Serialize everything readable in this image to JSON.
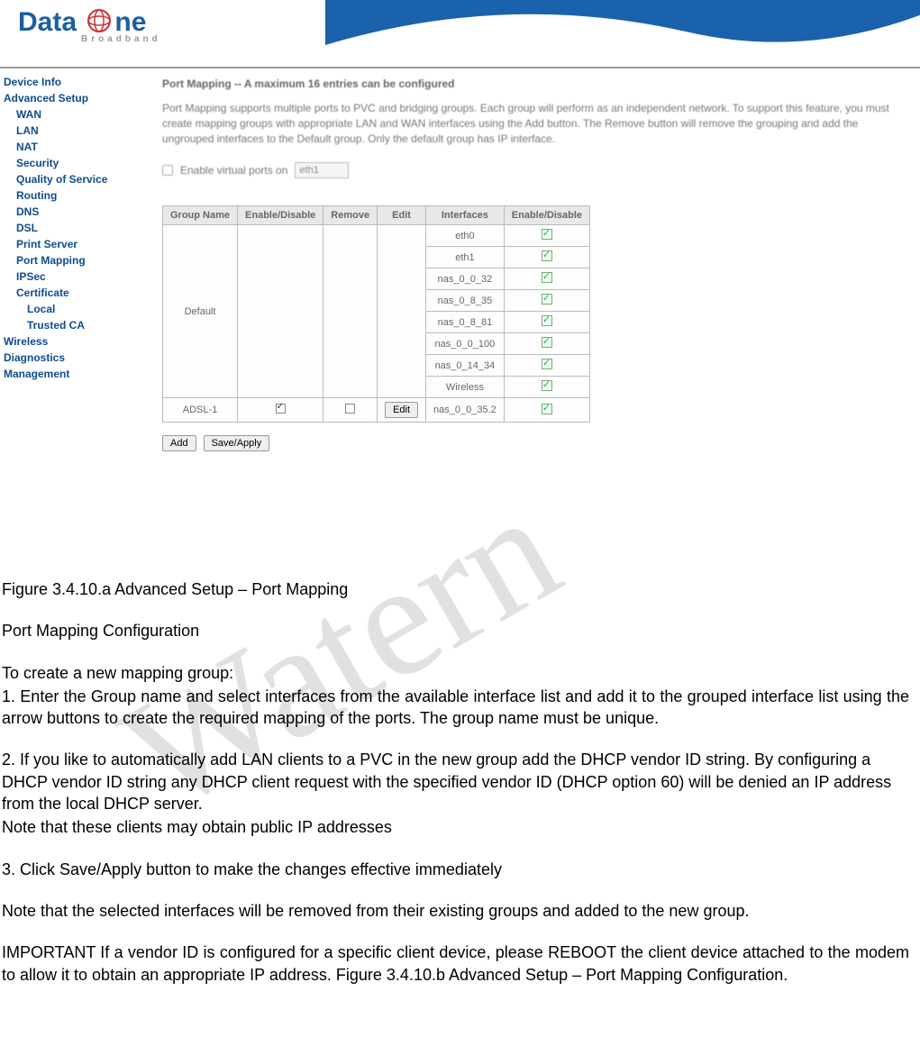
{
  "watermark": "Watern",
  "header": {
    "brand_a": "Data",
    "brand_b": "ne",
    "sub": "Broadband"
  },
  "sidebar": {
    "items": [
      {
        "label": "Device Info",
        "cls": "bold"
      },
      {
        "label": "Advanced Setup",
        "cls": "bold"
      },
      {
        "label": "WAN",
        "cls": "sub bold"
      },
      {
        "label": "LAN",
        "cls": "sub bold"
      },
      {
        "label": "NAT",
        "cls": "sub bold"
      },
      {
        "label": "Security",
        "cls": "sub bold"
      },
      {
        "label": "Quality of Service",
        "cls": "sub bold"
      },
      {
        "label": "Routing",
        "cls": "sub bold"
      },
      {
        "label": "DNS",
        "cls": "sub bold"
      },
      {
        "label": "DSL",
        "cls": "sub bold"
      },
      {
        "label": "Print Server",
        "cls": "sub bold"
      },
      {
        "label": "Port Mapping",
        "cls": "sub bold"
      },
      {
        "label": "IPSec",
        "cls": "sub bold"
      },
      {
        "label": "Certificate",
        "cls": "sub bold"
      },
      {
        "label": "Local",
        "cls": "subsub bold"
      },
      {
        "label": "Trusted CA",
        "cls": "subsub bold"
      },
      {
        "label": "Wireless",
        "cls": "bold"
      },
      {
        "label": "Diagnostics",
        "cls": "bold"
      },
      {
        "label": "Management",
        "cls": "bold"
      }
    ]
  },
  "content": {
    "title": "Port Mapping -- A maximum 16 entries can be configured",
    "desc": "Port Mapping supports multiple ports to PVC and bridging groups. Each group will perform as an independent network. To support this feature, you must create mapping groups with appropriate LAN and WAN interfaces using the Add button. The Remove button will remove the grouping and add the ungrouped interfaces to the Default group. Only the default group has IP interface.",
    "vp_label": "Enable virtual ports on",
    "vp_value": "eth1",
    "table": {
      "headers": [
        "Group Name",
        "Enable/Disable",
        "Remove",
        "Edit",
        "Interfaces",
        "Enable/Disable"
      ],
      "default_group": "Default",
      "interfaces": [
        "eth0",
        "eth1",
        "nas_0_0_32",
        "nas_0_8_35",
        "nas_0_8_81",
        "nas_0_0_100",
        "nas_0_14_34",
        "Wireless"
      ],
      "row2_group": "ADSL-1",
      "row2_iface": "nas_0_0_35.2",
      "edit_label": "Edit"
    },
    "btn_add": "Add",
    "btn_save": "Save/Apply"
  },
  "doc": {
    "caption": "Figure 3.4.10.a Advanced Setup – Port Mapping",
    "h1": "Port Mapping Configuration",
    "intro": "To create a new mapping group:",
    "s1": "1. Enter the Group name and select interfaces from the available interface list and add it to the grouped interface list using the arrow buttons to create the required mapping of the ports. The group name must be unique.",
    "s2a": "2. If you like to automatically add LAN clients to a PVC in the new group add the DHCP vendor ID string. By configuring a DHCP vendor ID string any DHCP client request with the specified vendor ID (DHCP option 60) will be denied an IP address from the local DHCP server.",
    "s2b": "Note that these clients may obtain public IP addresses",
    "s3": "3. Click Save/Apply button to make the changes effective immediately",
    "note": "Note that the selected interfaces will be removed from their existing groups and added to the new group.",
    "imp": "IMPORTANT If a vendor ID is configured for a specific client device, please REBOOT the client device attached to the modem to allow it to obtain an appropriate IP address. Figure 3.4.10.b Advanced Setup – Port Mapping Configuration."
  }
}
